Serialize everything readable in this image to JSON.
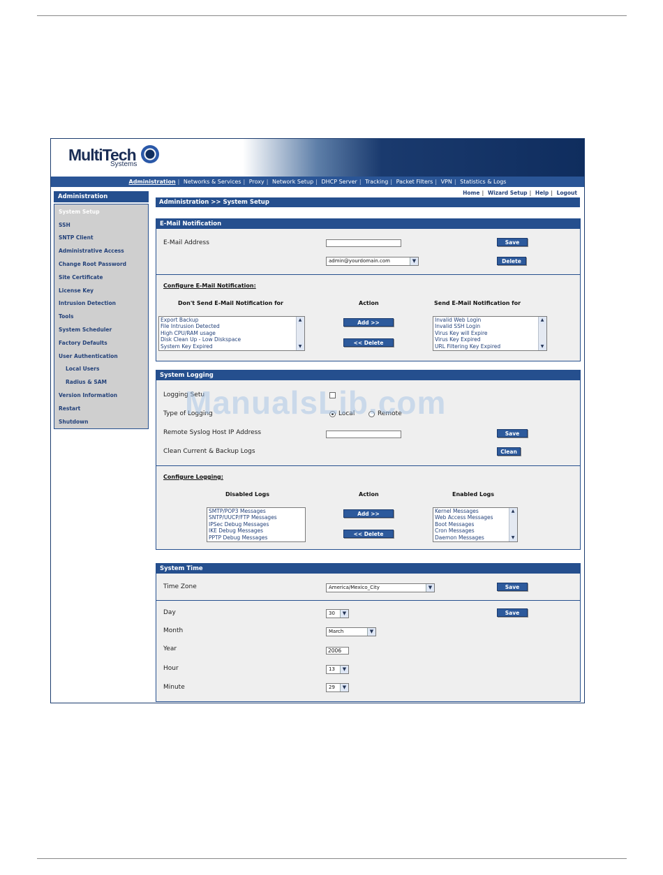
{
  "logo": {
    "word": "MultiTech",
    "sub": "Systems"
  },
  "topnav": [
    "Administration",
    "Networks & Services",
    "Proxy",
    "Network Setup",
    "DHCP Server",
    "Tracking",
    "Packet Filters",
    "VPN",
    "Statistics & Logs"
  ],
  "utilnav": [
    "Home",
    "Wizard Setup",
    "Help",
    "Logout"
  ],
  "sidebar": {
    "header": "Administration",
    "items": [
      "System Setup",
      "SSH",
      "SNTP Client",
      "Administrative Access",
      "Change Root Password",
      "Site Certificate",
      "License Key",
      "Intrusion Detection",
      "Tools",
      "System Scheduler",
      "Factory Defaults",
      "User Authentication",
      "Local Users",
      "Radius & SAM",
      "Version Information",
      "Restart",
      "Shutdown"
    ]
  },
  "breadcrumb": "Administration >> System Setup",
  "email": {
    "title": "E-Mail Notification",
    "address_label": "E-Mail Address",
    "address_value": "",
    "selected_address": "admin@yourdomain.com",
    "save": "Save",
    "delete": "Delete",
    "configure_label": "Configure E-Mail Notification:",
    "dont_send_header": "Don't Send E-Mail Notification for",
    "action_header": "Action",
    "send_header": "Send E-Mail Notification for",
    "dont_send_items": [
      "Export Backup",
      "File Intrusion Detected",
      "High CPU/RAM usage",
      "Disk Clean Up - Low Diskspace",
      "System Key Expired"
    ],
    "send_items": [
      "Invalid Web Login",
      "Invalid SSH Login",
      "Virus Key will Expire",
      "Virus Key Expired",
      "URL Filtering Key Expired"
    ],
    "add": "Add >>",
    "remove": "<< Delete"
  },
  "logging": {
    "title": "System Logging",
    "logging_setup_label": "Logging Setu",
    "type_label": "Type of Logging",
    "local": "Local",
    "remote": "Remote",
    "remote_host_label": "Remote Syslog Host IP Address",
    "remote_host_value": "",
    "save": "Save",
    "clean_label": "Clean Current & Backup Logs",
    "clean": "Clean",
    "configure_label": "Configure Logging:",
    "disabled_header": "Disabled Logs",
    "action_header": "Action",
    "enabled_header": "Enabled Logs",
    "disabled_items": [
      "SMTP/POP3 Messages",
      "SNTP/UUCP/FTP Messages",
      "IPSec Debug Messages",
      "IKE Debug Messages",
      "PPTP Debug Messages"
    ],
    "enabled_items": [
      "Kernel Messages",
      "Web Access Messages",
      "Boot Messages",
      "Cron Messages",
      "Daemon Messages"
    ],
    "add": "Add >>",
    "remove": "<< Delete"
  },
  "time": {
    "title": "System Time",
    "timezone_label": "Time Zone",
    "timezone_value": "America/Mexico_City",
    "save": "Save",
    "day_label": "Day",
    "day_value": "30",
    "month_label": "Month",
    "month_value": "March",
    "year_label": "Year",
    "year_value": "2006",
    "hour_label": "Hour",
    "hour_value": "13",
    "minute_label": "Minute",
    "minute_value": "29"
  },
  "watermark": "ManualsLib.com"
}
